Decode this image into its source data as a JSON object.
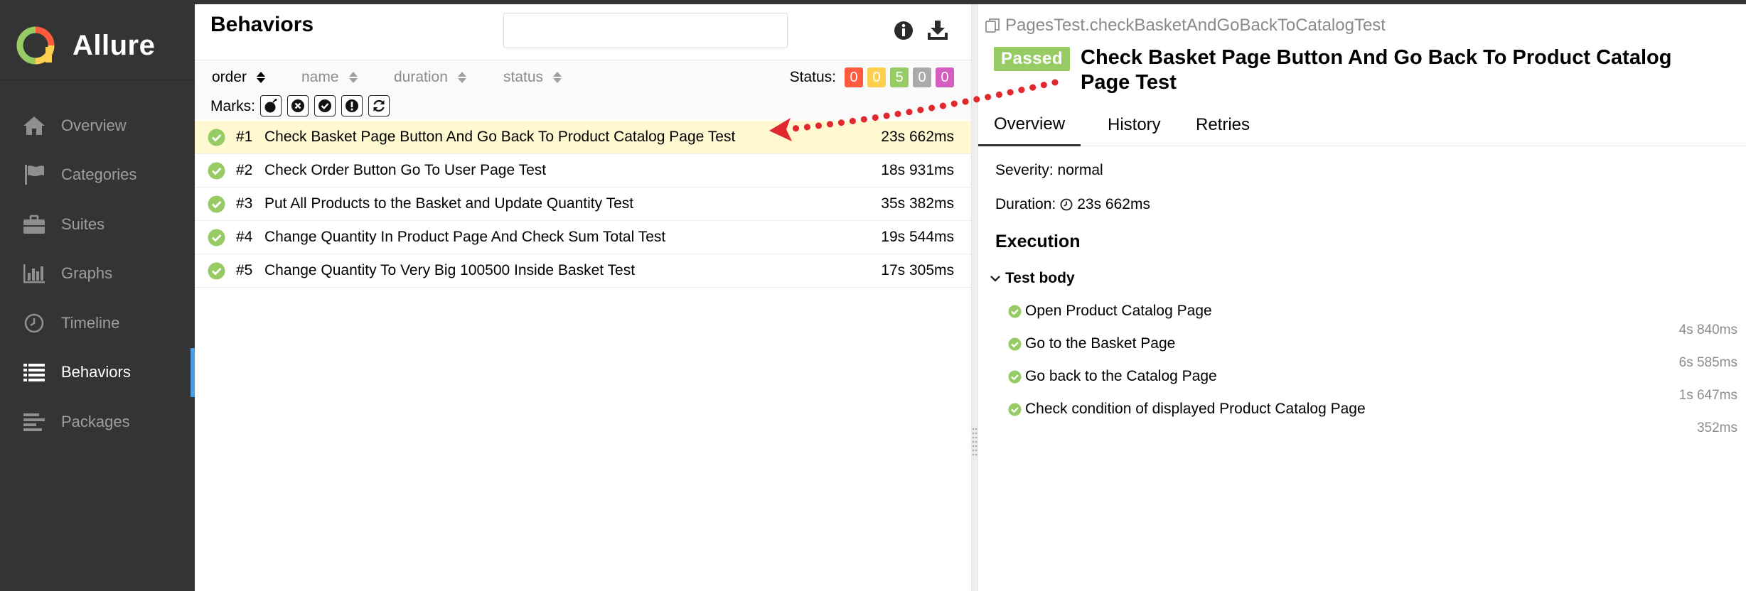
{
  "app": {
    "name": "Allure"
  },
  "sidebar": {
    "items": [
      {
        "label": "Overview",
        "icon": "home-icon"
      },
      {
        "label": "Categories",
        "icon": "flag-icon"
      },
      {
        "label": "Suites",
        "icon": "briefcase-icon"
      },
      {
        "label": "Graphs",
        "icon": "bar-chart-icon"
      },
      {
        "label": "Timeline",
        "icon": "clock-icon"
      },
      {
        "label": "Behaviors",
        "icon": "list-icon",
        "active": true
      },
      {
        "label": "Packages",
        "icon": "align-left-icon"
      }
    ]
  },
  "behaviors": {
    "title": "Behaviors",
    "search_value": "",
    "sort": {
      "order": "order",
      "name": "name",
      "duration": "duration",
      "status": "status"
    },
    "status_label": "Status:",
    "status_counts": [
      {
        "value": "0",
        "color": "#fd5a3e"
      },
      {
        "value": "0",
        "color": "#ffd050"
      },
      {
        "value": "5",
        "color": "#97cc64"
      },
      {
        "value": "0",
        "color": "#aaaaaa"
      },
      {
        "value": "0",
        "color": "#d35ebe"
      }
    ],
    "marks_label": "Marks:",
    "marks": [
      "bomb-icon",
      "times-circle-icon",
      "check-circle-icon",
      "exclamation-circle-icon",
      "refresh-icon"
    ],
    "rows": [
      {
        "num": "#1",
        "name": "Check Basket Page Button And Go Back To Product Catalog Page Test",
        "duration": "23s 662ms",
        "selected": true
      },
      {
        "num": "#2",
        "name": "Check Order Button Go To User Page Test",
        "duration": "18s 931ms"
      },
      {
        "num": "#3",
        "name": "Put All Products to the Basket and Update Quantity Test",
        "duration": "35s 382ms"
      },
      {
        "num": "#4",
        "name": "Change Quantity In Product Page And Check Sum Total Test",
        "duration": "19s 544ms"
      },
      {
        "num": "#5",
        "name": "Change Quantity To Very Big 100500 Inside Basket Test",
        "duration": "17s 305ms"
      }
    ]
  },
  "detail": {
    "breadcrumb": "PagesTest.checkBasketAndGoBackToCatalogTest",
    "status": "Passed",
    "title": "Check Basket Page Button And Go Back To Product Catalog Page Test",
    "tabs": [
      "Overview",
      "History",
      "Retries"
    ],
    "severity": "Severity: normal",
    "duration_label": "Duration:",
    "duration_value": "23s 662ms",
    "execution_title": "Execution",
    "test_body_label": "Test body",
    "steps": [
      {
        "name": "Open Product Catalog Page",
        "duration": "4s 840ms"
      },
      {
        "name": "Go to the Basket Page",
        "duration": "6s 585ms"
      },
      {
        "name": "Go back to the Catalog Page",
        "duration": "1s 647ms"
      },
      {
        "name": "Check condition of displayed Product Catalog Page",
        "duration": "352ms"
      }
    ]
  },
  "colors": {
    "sidebar_bg": "#343434",
    "accent": "#4a9ee8",
    "passed": "#97cc64",
    "selected_row": "#fff8d0",
    "annotation_arrow": "#e0282e"
  }
}
